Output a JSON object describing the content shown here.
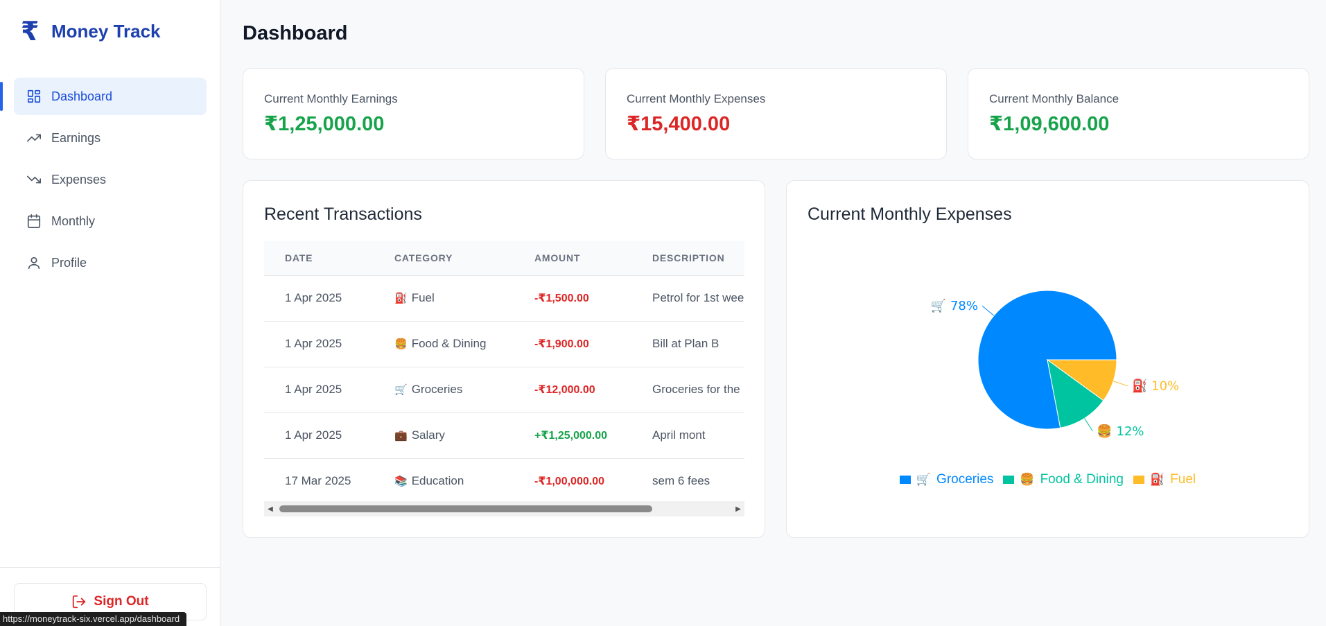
{
  "app": {
    "logo_symbol": "₹",
    "name": "Money Track"
  },
  "sidebar": {
    "items": [
      {
        "label": "Dashboard",
        "icon": "dashboard-grid-icon",
        "active": true
      },
      {
        "label": "Earnings",
        "icon": "trending-up-icon",
        "active": false
      },
      {
        "label": "Expenses",
        "icon": "trending-down-icon",
        "active": false
      },
      {
        "label": "Monthly",
        "icon": "calendar-icon",
        "active": false
      },
      {
        "label": "Profile",
        "icon": "user-icon",
        "active": false
      }
    ],
    "signout_label": "Sign Out"
  },
  "status_bar_url": "https://moneytrack-six.vercel.app/dashboard",
  "page_title": "Dashboard",
  "stats": [
    {
      "label": "Current Monthly Earnings",
      "value": "₹1,25,000.00",
      "color": "#16a34a"
    },
    {
      "label": "Current Monthly Expenses",
      "value": "₹15,400.00",
      "color": "#dc2626"
    },
    {
      "label": "Current Monthly Balance",
      "value": "₹1,09,600.00",
      "color": "#16a34a"
    }
  ],
  "transactions": {
    "title": "Recent Transactions",
    "columns": [
      "DATE",
      "CATEGORY",
      "AMOUNT",
      "DESCRIPTION"
    ],
    "rows": [
      {
        "date": "1 Apr 2025",
        "emoji": "⛽",
        "category": "Fuel",
        "amount": "-₹1,500.00",
        "type": "expense",
        "description": "Petrol for 1st wee"
      },
      {
        "date": "1 Apr 2025",
        "emoji": "🍔",
        "category": "Food & Dining",
        "amount": "-₹1,900.00",
        "type": "expense",
        "description": "Bill at Plan B"
      },
      {
        "date": "1 Apr 2025",
        "emoji": "🛒",
        "category": "Groceries",
        "amount": "-₹12,000.00",
        "type": "expense",
        "description": "Groceries for the"
      },
      {
        "date": "1 Apr 2025",
        "emoji": "💼",
        "category": "Salary",
        "amount": "+₹1,25,000.00",
        "type": "income",
        "description": "April mont"
      },
      {
        "date": "17 Mar 2025",
        "emoji": "📚",
        "category": "Education",
        "amount": "-₹1,00,000.00",
        "type": "expense",
        "description": "sem 6 fees"
      }
    ]
  },
  "expenses_chart": {
    "title": "Current Monthly Expenses"
  },
  "chart_data": {
    "type": "pie",
    "title": "Current Monthly Expenses",
    "categories": [
      "Groceries",
      "Food & Dining",
      "Fuel"
    ],
    "emojis": [
      "🛒",
      "🍔",
      "⛽"
    ],
    "values": [
      78,
      12,
      10
    ],
    "labels": [
      "78%",
      "12%",
      "10%"
    ],
    "colors": [
      "#0088fe",
      "#00c49f",
      "#ffbb28"
    ],
    "legend": "bottom"
  }
}
